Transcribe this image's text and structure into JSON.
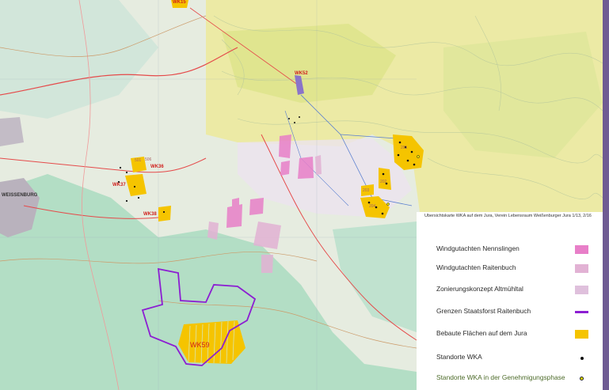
{
  "legend": {
    "caption": "Übersichtskarte WKA auf dem Jura, Verein Lebensraum Weißenburger Jura 1/13, 2/16",
    "items": [
      {
        "label": "Windgutachten Nennslingen",
        "color": "#e87fc8",
        "kind": "fill"
      },
      {
        "label": "Windgutachten Raitenbuch",
        "color": "#e2b2d4",
        "kind": "fill"
      },
      {
        "label": "Zonierungskonzept  Altmühltal",
        "color": "#dfc0dc",
        "kind": "fill"
      },
      {
        "label": "Grenzen Staatsforst Raitenbuch",
        "color": "#8c1ed2",
        "kind": "line"
      },
      {
        "label": "Bebaute Flächen auf dem Jura",
        "color": "#f5c400",
        "kind": "fill"
      },
      {
        "label": "Standorte WKA",
        "color": "#111111",
        "kind": "dot"
      },
      {
        "label": "Standorte WKA  in der Genehmigungsphase",
        "color": "#e8e000",
        "kind": "dot-ring"
      }
    ]
  },
  "map": {
    "wind_labels": [
      {
        "text": "WK59",
        "cls": "wk-label wk59"
      },
      {
        "text": "WK38",
        "cls": "wk-label"
      },
      {
        "text": "WK37",
        "cls": "wk-label"
      },
      {
        "text": "WK36",
        "cls": "wk-label"
      },
      {
        "text": "WK15",
        "cls": "wk-label"
      },
      {
        "text": "WK52",
        "cls": "wk-label"
      }
    ],
    "site_codes": [
      "501",
      "506",
      "202",
      "203",
      "204",
      "201"
    ],
    "town_labels": [
      "WEISSENBURG"
    ],
    "colors": {
      "base": "#e6ece0",
      "forest": "#a9dcc0",
      "jura": "#eceb9a",
      "road_red": "#e54a4a",
      "road_blue": "#5a7fd0",
      "forest_boundary": "#8c1ed2"
    }
  }
}
